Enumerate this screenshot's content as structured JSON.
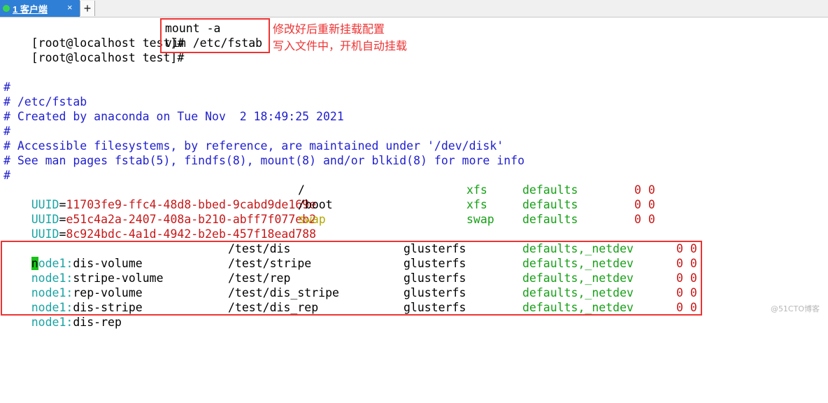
{
  "tab": {
    "label": "1 客户端",
    "close": "×",
    "new": "+"
  },
  "prompt_lines": [
    {
      "prompt": "[root@localhost test]#",
      "cmd": "mount -a"
    },
    {
      "prompt": "[root@localhost test]#",
      "cmd": "vim /etc/fstab"
    }
  ],
  "annotations": [
    "修改好后重新挂载配置",
    "写入文件中，开机自动挂载"
  ],
  "comments": [
    "#",
    "# /etc/fstab",
    "# Created by anaconda on Tue Nov  2 18:49:25 2021",
    "#",
    "# Accessible filesystems, by reference, are maintained under '/dev/disk'",
    "# See man pages fstab(5), findfs(8), mount(8) and/or blkid(8) for more info",
    "#"
  ],
  "uuid_rows": [
    {
      "key": "UUID",
      "sep": "=",
      "value": "11703fe9-ffc4-48d8-bbed-9cabd9de169e",
      "mount": "/",
      "type": "xfs",
      "opts": "defaults",
      "nums": "0 0"
    },
    {
      "key": "UUID",
      "sep": "=",
      "value": "e51c4a2a-2407-408a-b210-abff7f077eb2",
      "mount": "/boot",
      "type": "xfs",
      "opts": "defaults",
      "nums": "0 0"
    },
    {
      "key": "UUID",
      "sep": "=",
      "value": "8c924bdc-4a1d-4942-b2eb-457f18ead788",
      "mount": "swap",
      "type": "swap",
      "opts": "defaults",
      "nums": "0 0"
    }
  ],
  "gluster_rows": [
    {
      "host": "node1",
      "sep": ":",
      "vol": "dis-volume",
      "mount": "/test/dis",
      "type": "glusterfs",
      "opts": "defaults,_netdev",
      "nums": "0 0"
    },
    {
      "host": "node1",
      "sep": ":",
      "vol": "stripe-volume",
      "mount": "/test/stripe",
      "type": "glusterfs",
      "opts": "defaults,_netdev",
      "nums": "0 0"
    },
    {
      "host": "node1",
      "sep": ":",
      "vol": "rep-volume",
      "mount": "/test/rep",
      "type": "glusterfs",
      "opts": "defaults,_netdev",
      "nums": "0 0"
    },
    {
      "host": "node1",
      "sep": ":",
      "vol": "dis-stripe",
      "mount": "/test/dis_stripe",
      "type": "glusterfs",
      "opts": "defaults,_netdev",
      "nums": "0 0"
    },
    {
      "host": "node1",
      "sep": ":",
      "vol": "dis-rep",
      "mount": "/test/dis_rep",
      "type": "glusterfs",
      "opts": "defaults,_netdev",
      "nums": "0 0"
    }
  ],
  "colors": {
    "accent": "#2f7fd6",
    "highlight_box": "#e33333",
    "comment": "#1f1fd0",
    "type": "#17a117",
    "uuid_value": "#c81818",
    "key": "#1ba3a3"
  },
  "watermark": "@51CTO博客"
}
